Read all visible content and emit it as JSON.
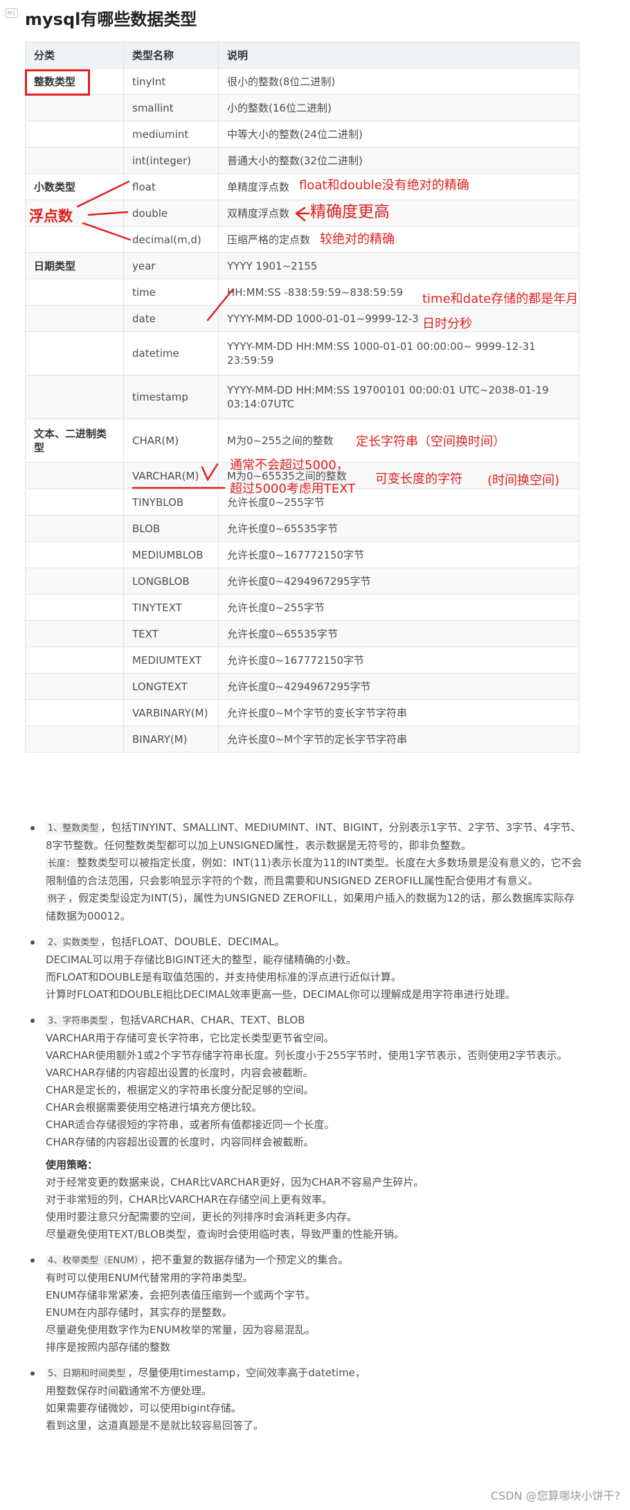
{
  "page": {
    "icon_label": "M↓",
    "title": "mysql有哪些数据类型"
  },
  "table": {
    "headers": [
      "分类",
      "类型名称",
      "说明"
    ],
    "rows": [
      {
        "category": "整数类型",
        "name": "tinyInt",
        "desc": "很小的整数(8位二进制)"
      },
      {
        "category": "",
        "name": "smallint",
        "desc": "小的整数(16位二进制)"
      },
      {
        "category": "",
        "name": "mediumint",
        "desc": "中等大小的整数(24位二进制)"
      },
      {
        "category": "",
        "name": "int(integer)",
        "desc": "普通大小的整数(32位二进制)"
      },
      {
        "category": "小数类型",
        "name": "float",
        "desc": "单精度浮点数"
      },
      {
        "category": "",
        "name": "double",
        "desc": "双精度浮点数"
      },
      {
        "category": "",
        "name": "decimal(m,d)",
        "desc": "压缩严格的定点数"
      },
      {
        "category": "日期类型",
        "name": "year",
        "desc": "YYYY 1901~2155"
      },
      {
        "category": "",
        "name": "time",
        "desc": "HH:MM:SS -838:59:59~838:59:59"
      },
      {
        "category": "",
        "name": "date",
        "desc": "YYYY-MM-DD 1000-01-01~9999-12-3"
      },
      {
        "category": "",
        "name": "datetime",
        "desc": "YYYY-MM-DD HH:MM:SS 1000-01-01 00:00:00~ 9999-12-31 23:59:59"
      },
      {
        "category": "",
        "name": "timestamp",
        "desc": "YYYY-MM-DD HH:MM:SS 19700101 00:00:01 UTC~2038-01-19 03:14:07UTC"
      },
      {
        "category": "文本、二进制类型",
        "name": "CHAR(M)",
        "desc": "M为0~255之间的整数"
      },
      {
        "category": "",
        "name": "VARCHAR(M)",
        "desc": "M为0~65535之间的整数"
      },
      {
        "category": "",
        "name": "TINYBLOB",
        "desc": "允许长度0~255字节"
      },
      {
        "category": "",
        "name": "BLOB",
        "desc": "允许长度0~65535字节"
      },
      {
        "category": "",
        "name": "MEDIUMBLOB",
        "desc": "允许长度0~167772150字节"
      },
      {
        "category": "",
        "name": "LONGBLOB",
        "desc": "允许长度0~4294967295字节"
      },
      {
        "category": "",
        "name": "TINYTEXT",
        "desc": "允许长度0~255字节"
      },
      {
        "category": "",
        "name": "TEXT",
        "desc": "允许长度0~65535字节"
      },
      {
        "category": "",
        "name": "MEDIUMTEXT",
        "desc": "允许长度0~167772150字节"
      },
      {
        "category": "",
        "name": "LONGTEXT",
        "desc": "允许长度0~4294967295字节"
      },
      {
        "category": "",
        "name": "VARBINARY(M)",
        "desc": "允许长度0~M个字节的变长字节字符串"
      },
      {
        "category": "",
        "name": "BINARY(M)",
        "desc": "允许长度0~M个字节的定长字节字符串"
      }
    ]
  },
  "annotations": {
    "float_double": "float和double没有绝对的精确",
    "precision_higher": "精确度更高",
    "decimal_exact": "较绝对的精确",
    "float_label": "浮点数",
    "time_date_1": "time和date存储的都是年月",
    "time_date_2": "日时分秒",
    "char_fixed": "定长字符串（空间换时间）",
    "varchar_1": "通常不会超过5000，",
    "varchar_2": "超过5000考虑用TEXT",
    "varchar_variable": "可变长度的字符",
    "varchar_time_space": "(时间换空间)"
  },
  "notes": {
    "n1": {
      "code": "1、整数类型",
      "text": "，包括TINYINT、SMALLINT、MEDIUMINT、INT、BIGINT，分别表示1字节、2字节、3字节、4字节、8字节整数。任何整数类型都可以加上UNSIGNED属性，表示数据是无符号的，即非负整数。",
      "len_code": "长度：",
      "len_text": "整数类型可以被指定长度，例如：INT(11)表示长度为11的INT类型。长度在大多数场景是没有意义的，它不会限制值的合法范围，只会影响显示字符的个数，而且需要和UNSIGNED ZEROFILL属性配合使用才有意义。",
      "ex_code": "例子",
      "ex_text": "，假定类型设定为INT(5)，属性为UNSIGNED ZEROFILL，如果用户插入的数据为12的话，那么数据库实际存储数据为00012。"
    },
    "n2": {
      "code": "2、实数类型",
      "text": "，包括FLOAT、DOUBLE、DECIMAL。",
      "lines": [
        "DECIMAL可以用于存储比BIGINT还大的整型，能存储精确的小数。",
        "而FLOAT和DOUBLE是有取值范围的，并支持使用标准的浮点进行近似计算。",
        "计算时FLOAT和DOUBLE相比DECIMAL效率更高一些，DECIMAL你可以理解成是用字符串进行处理。"
      ]
    },
    "n3": {
      "code": "3、字符串类型",
      "text": "，包括VARCHAR、CHAR、TEXT、BLOB",
      "lines": [
        "VARCHAR用于存储可变长字符串，它比定长类型更节省空间。",
        "VARCHAR使用额外1或2个字节存储字符串长度。列长度小于255字节时，使用1字节表示，否则使用2字节表示。",
        "VARCHAR存储的内容超出设置的长度时，内容会被截断。",
        "CHAR是定长的，根据定义的字符串长度分配足够的空间。",
        "CHAR会根据需要使用空格进行填充方便比较。",
        "CHAR适合存储很短的字符串，或者所有值都接近同一个长度。",
        "CHAR存储的内容超出设置的长度时，内容同样会被截断。"
      ],
      "strategy_title": "使用策略：",
      "strategy_lines": [
        "对于经常变更的数据来说，CHAR比VARCHAR更好，因为CHAR不容易产生碎片。",
        "对于非常短的列，CHAR比VARCHAR在存储空间上更有效率。",
        "使用时要注意只分配需要的空间，更长的列排序时会消耗更多内存。",
        "尽量避免使用TEXT/BLOB类型，查询时会使用临时表，导致严重的性能开销。"
      ]
    },
    "n4": {
      "code": "4、枚举类型（ENUM）",
      "text": "，把不重复的数据存储为一个预定义的集合。",
      "lines": [
        "有时可以使用ENUM代替常用的字符串类型。",
        "ENUM存储非常紧凑，会把列表值压缩到一个或两个字节。",
        "ENUM在内部存储时，其实存的是整数。",
        "尽量避免使用数字作为ENUM枚举的常量，因为容易混乱。",
        "排序是按照内部存储的整数"
      ]
    },
    "n5": {
      "code": "5、日期和时间类型",
      "text": "，尽量使用timestamp，空间效率高于datetime，",
      "lines": [
        "用整数保存时间戳通常不方便处理。",
        "如果需要存储微妙，可以使用bigint存储。",
        "看到这里，这道真题是不是就比较容易回答了。"
      ]
    }
  },
  "watermark": "CSDN @您算哪块小饼干?",
  "colors": {
    "annotation": "#e02020",
    "table_border": "#dfe2e5",
    "header_bg": "#eff3f5"
  }
}
